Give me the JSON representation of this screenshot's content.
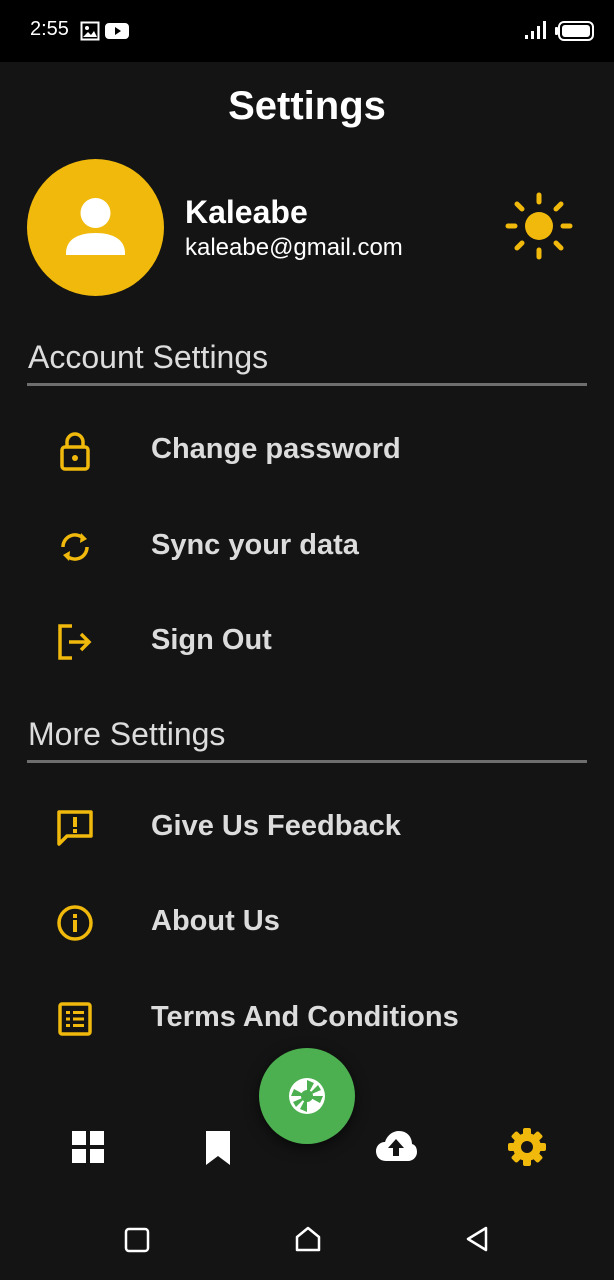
{
  "status_bar": {
    "time": "2:55",
    "icons": [
      "image-icon",
      "youtube-icon",
      "signal-icon",
      "battery-icon"
    ]
  },
  "header": {
    "title": "Settings"
  },
  "profile": {
    "name": "Kaleabe",
    "email": "kaleabe@gmail.com",
    "avatar_icon": "person-icon",
    "theme_icon": "sun-icon"
  },
  "sections": [
    {
      "title": "Account Settings",
      "items": [
        {
          "label": "Change password",
          "icon": "lock-icon"
        },
        {
          "label": "Sync your data",
          "icon": "sync-icon"
        },
        {
          "label": "Sign Out",
          "icon": "logout-icon"
        }
      ]
    },
    {
      "title": "More Settings",
      "items": [
        {
          "label": "Give Us Feedback",
          "icon": "feedback-icon"
        },
        {
          "label": "About Us",
          "icon": "info-icon"
        },
        {
          "label": "Terms And Conditions",
          "icon": "list-icon"
        }
      ]
    }
  ],
  "bottom_nav": {
    "items": [
      "dashboard-icon",
      "bookmark-icon",
      "upload-icon",
      "settings-gear-icon"
    ],
    "active": "settings-gear-icon",
    "fab_icon": "camera-shutter-icon"
  },
  "colors": {
    "background": "#141414",
    "accent": "#f0b90b",
    "fab": "#4caf50",
    "text": "#dcdcdc"
  }
}
